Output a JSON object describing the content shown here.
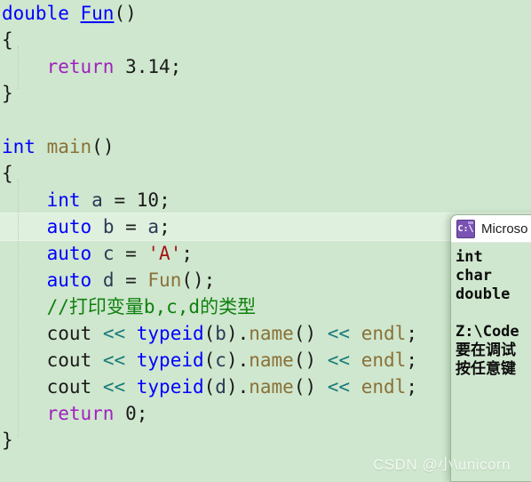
{
  "editor": {
    "background_color": "#cfe7ce",
    "current_line_highlight_color": "#dff0de",
    "lines": [
      {
        "n": 1,
        "segments": [
          {
            "t": "double",
            "c": "kw"
          },
          {
            "t": " ",
            "c": "plain"
          },
          {
            "t": "Fun",
            "c": "fnlink"
          },
          {
            "t": "()",
            "c": "punct"
          }
        ]
      },
      {
        "n": 2,
        "segments": [
          {
            "t": "{",
            "c": "punct"
          }
        ]
      },
      {
        "n": 3,
        "segments": [
          {
            "t": "    ",
            "c": "plain"
          },
          {
            "t": "return",
            "c": "ctrl"
          },
          {
            "t": " ",
            "c": "plain"
          },
          {
            "t": "3.14",
            "c": "num"
          },
          {
            "t": ";",
            "c": "punct"
          }
        ]
      },
      {
        "n": 4,
        "segments": [
          {
            "t": "}",
            "c": "punct"
          }
        ]
      },
      {
        "n": 5,
        "segments": []
      },
      {
        "n": 6,
        "segments": [
          {
            "t": "int",
            "c": "kw"
          },
          {
            "t": " ",
            "c": "plain"
          },
          {
            "t": "main",
            "c": "fncall"
          },
          {
            "t": "()",
            "c": "punct"
          }
        ]
      },
      {
        "n": 7,
        "segments": [
          {
            "t": "{",
            "c": "punct"
          }
        ]
      },
      {
        "n": 8,
        "segments": [
          {
            "t": "    ",
            "c": "plain"
          },
          {
            "t": "int",
            "c": "kw"
          },
          {
            "t": " ",
            "c": "plain"
          },
          {
            "t": "a",
            "c": "ident"
          },
          {
            "t": " = ",
            "c": "punct"
          },
          {
            "t": "10",
            "c": "num"
          },
          {
            "t": ";",
            "c": "punct"
          }
        ]
      },
      {
        "n": 9,
        "highlight": true,
        "segments": [
          {
            "t": "    ",
            "c": "plain"
          },
          {
            "t": "auto",
            "c": "kw"
          },
          {
            "t": " ",
            "c": "plain"
          },
          {
            "t": "b",
            "c": "ident"
          },
          {
            "t": " = ",
            "c": "punct"
          },
          {
            "t": "a",
            "c": "ident"
          },
          {
            "t": ";",
            "c": "punct"
          }
        ]
      },
      {
        "n": 10,
        "segments": [
          {
            "t": "    ",
            "c": "plain"
          },
          {
            "t": "auto",
            "c": "kw"
          },
          {
            "t": " ",
            "c": "plain"
          },
          {
            "t": "c",
            "c": "ident"
          },
          {
            "t": " = ",
            "c": "punct"
          },
          {
            "t": "'A'",
            "c": "chr"
          },
          {
            "t": ";",
            "c": "punct"
          }
        ]
      },
      {
        "n": 11,
        "segments": [
          {
            "t": "    ",
            "c": "plain"
          },
          {
            "t": "auto",
            "c": "kw"
          },
          {
            "t": " ",
            "c": "plain"
          },
          {
            "t": "d",
            "c": "ident"
          },
          {
            "t": " = ",
            "c": "punct"
          },
          {
            "t": "Fun",
            "c": "fncall"
          },
          {
            "t": "()",
            "c": "punct"
          },
          {
            "t": ";",
            "c": "punct"
          }
        ]
      },
      {
        "n": 12,
        "segments": [
          {
            "t": "    ",
            "c": "plain"
          },
          {
            "t": "//打印变量b,c,d的类型",
            "c": "comment"
          }
        ]
      },
      {
        "n": 13,
        "segments": [
          {
            "t": "    ",
            "c": "plain"
          },
          {
            "t": "cout",
            "c": "plain"
          },
          {
            "t": " ",
            "c": "plain"
          },
          {
            "t": "<<",
            "c": "op"
          },
          {
            "t": " ",
            "c": "plain"
          },
          {
            "t": "typeid",
            "c": "kw"
          },
          {
            "t": "(",
            "c": "punct"
          },
          {
            "t": "b",
            "c": "ident"
          },
          {
            "t": ")",
            "c": "punct"
          },
          {
            "t": ".",
            "c": "memberdot"
          },
          {
            "t": "name",
            "c": "fncall"
          },
          {
            "t": "()",
            "c": "punct"
          },
          {
            "t": " ",
            "c": "plain"
          },
          {
            "t": "<<",
            "c": "op"
          },
          {
            "t": " ",
            "c": "plain"
          },
          {
            "t": "endl",
            "c": "fncall"
          },
          {
            "t": ";",
            "c": "punct"
          }
        ]
      },
      {
        "n": 14,
        "segments": [
          {
            "t": "    ",
            "c": "plain"
          },
          {
            "t": "cout",
            "c": "plain"
          },
          {
            "t": " ",
            "c": "plain"
          },
          {
            "t": "<<",
            "c": "op"
          },
          {
            "t": " ",
            "c": "plain"
          },
          {
            "t": "typeid",
            "c": "kw"
          },
          {
            "t": "(",
            "c": "punct"
          },
          {
            "t": "c",
            "c": "ident"
          },
          {
            "t": ")",
            "c": "punct"
          },
          {
            "t": ".",
            "c": "memberdot"
          },
          {
            "t": "name",
            "c": "fncall"
          },
          {
            "t": "()",
            "c": "punct"
          },
          {
            "t": " ",
            "c": "plain"
          },
          {
            "t": "<<",
            "c": "op"
          },
          {
            "t": " ",
            "c": "plain"
          },
          {
            "t": "endl",
            "c": "fncall"
          },
          {
            "t": ";",
            "c": "punct"
          }
        ]
      },
      {
        "n": 15,
        "segments": [
          {
            "t": "    ",
            "c": "plain"
          },
          {
            "t": "cout",
            "c": "plain"
          },
          {
            "t": " ",
            "c": "plain"
          },
          {
            "t": "<<",
            "c": "op"
          },
          {
            "t": " ",
            "c": "plain"
          },
          {
            "t": "typeid",
            "c": "kw"
          },
          {
            "t": "(",
            "c": "punct"
          },
          {
            "t": "d",
            "c": "ident"
          },
          {
            "t": ")",
            "c": "punct"
          },
          {
            "t": ".",
            "c": "memberdot"
          },
          {
            "t": "name",
            "c": "fncall"
          },
          {
            "t": "()",
            "c": "punct"
          },
          {
            "t": " ",
            "c": "plain"
          },
          {
            "t": "<<",
            "c": "op"
          },
          {
            "t": " ",
            "c": "plain"
          },
          {
            "t": "endl",
            "c": "fncall"
          },
          {
            "t": ";",
            "c": "punct"
          }
        ]
      },
      {
        "n": 16,
        "segments": [
          {
            "t": "    ",
            "c": "plain"
          },
          {
            "t": "return",
            "c": "ctrl"
          },
          {
            "t": " ",
            "c": "plain"
          },
          {
            "t": "0",
            "c": "num"
          },
          {
            "t": ";",
            "c": "punct"
          }
        ]
      },
      {
        "n": 17,
        "segments": [
          {
            "t": "}",
            "c": "punct"
          }
        ]
      }
    ]
  },
  "console": {
    "icon": "console-cmd-icon",
    "title": "Microso",
    "output_lines": [
      "int",
      "char",
      "double",
      "",
      "Z:\\Code",
      "要在调试",
      "按任意键"
    ]
  },
  "watermark": {
    "text": "CSDN @小\\unicorn"
  }
}
